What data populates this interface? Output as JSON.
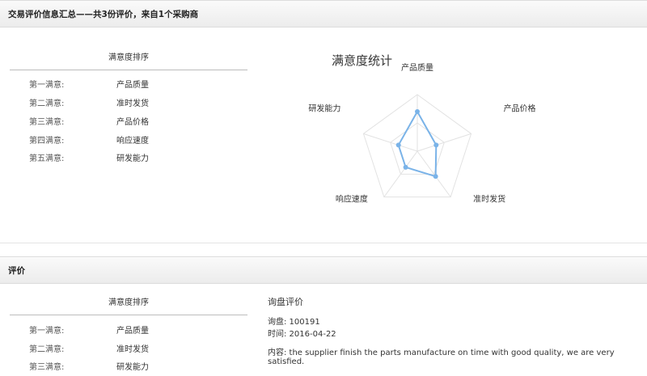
{
  "summary": {
    "header": "交易评价信息汇总——共3份评价，来自1个采购商",
    "ranking_title": "满意度排序",
    "ranking": [
      {
        "label": "第一满意:",
        "value": "产品质量"
      },
      {
        "label": "第二满意:",
        "value": "准时发货"
      },
      {
        "label": "第三满意:",
        "value": "产品价格"
      },
      {
        "label": "第四满意:",
        "value": "响应速度"
      },
      {
        "label": "第五满意:",
        "value": "研发能力"
      }
    ]
  },
  "chart_data": {
    "type": "radar",
    "title": "满意度统计",
    "axes": [
      "产品质量",
      "产品价格",
      "准时发货",
      "响应速度",
      "研发能力"
    ],
    "series": [
      {
        "values": [
          0.7,
          0.35,
          0.55,
          0.35,
          0.35
        ]
      }
    ],
    "range": [
      0,
      1
    ],
    "line_color": "#7ab3e8",
    "grid_color": "#e2e2e2"
  },
  "review": {
    "header": "评价",
    "ranking_title": "满意度排序",
    "ranking": [
      {
        "label": "第一满意:",
        "value": "产品质量"
      },
      {
        "label": "第二满意:",
        "value": "准时发货"
      },
      {
        "label": "第三满意:",
        "value": "研发能力"
      }
    ],
    "eval_title": "询盘评价",
    "inquiry": "询盘: 100191",
    "time": "时间: 2016-04-22",
    "content": "内容: the supplier finish the parts manufacture on time with good quality, we are very satisfied."
  }
}
